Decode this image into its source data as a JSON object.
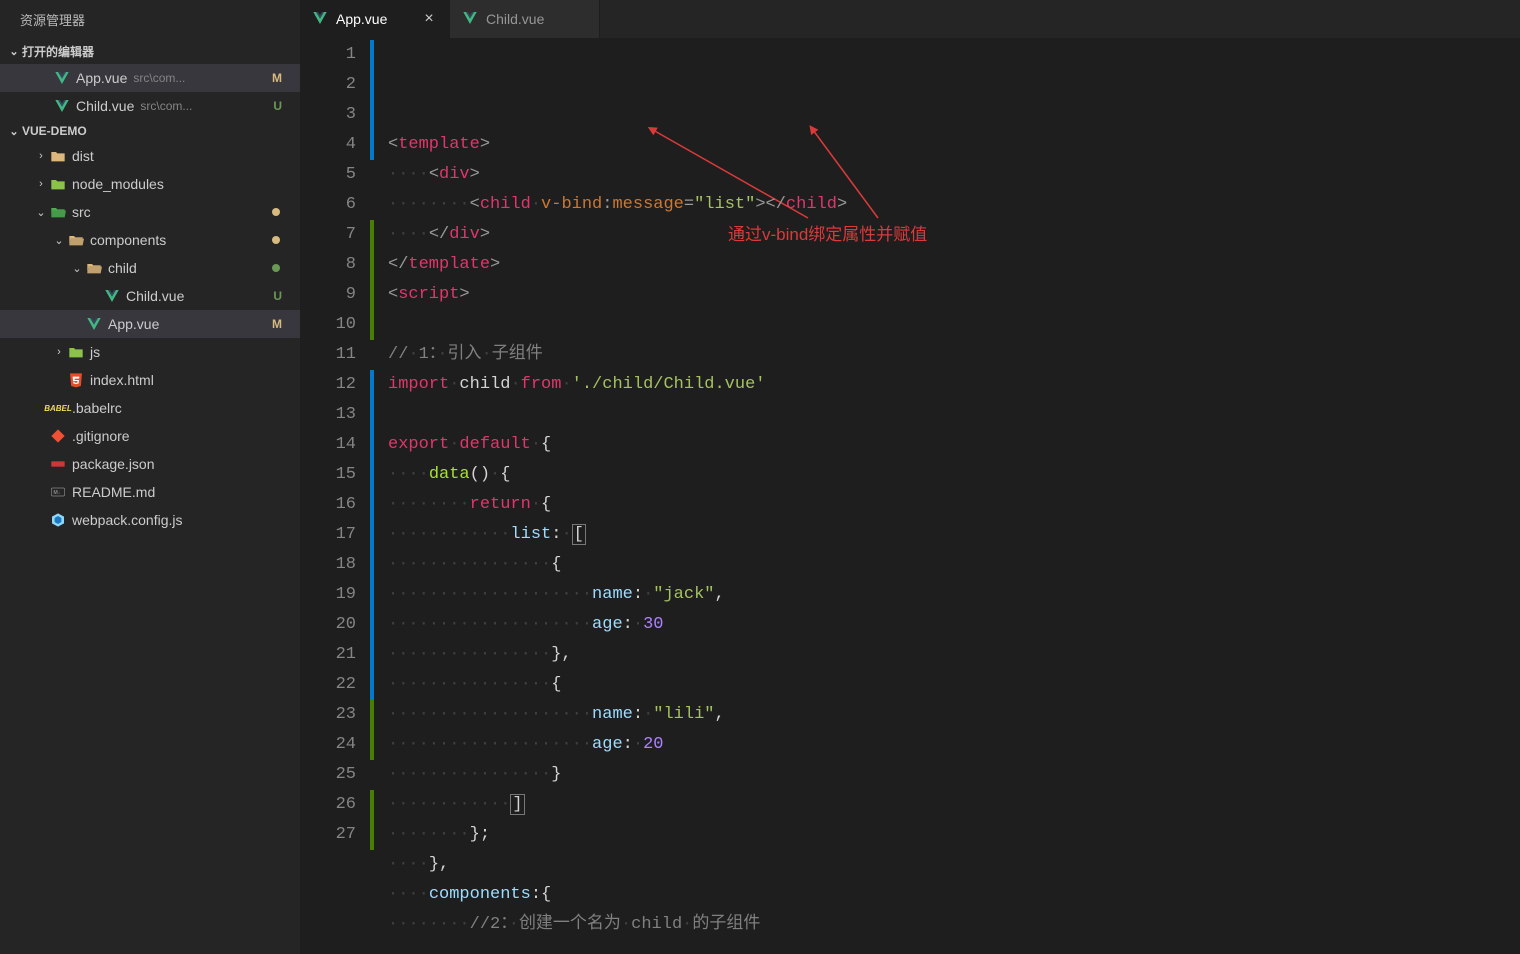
{
  "sidebar": {
    "title": "资源管理器",
    "openEditorsHeader": "打开的编辑器",
    "projectHeader": "VUE-DEMO",
    "openEditors": [
      {
        "name": "App.vue",
        "path": "src\\com...",
        "badge": "M",
        "icon": "vue"
      },
      {
        "name": "Child.vue",
        "path": "src\\com...",
        "badge": "U",
        "icon": "vue"
      }
    ],
    "tree": [
      {
        "indent": 1,
        "type": "folder-closed",
        "name": "dist",
        "chev": "›"
      },
      {
        "indent": 1,
        "type": "folder-closed-js",
        "name": "node_modules",
        "chev": "›"
      },
      {
        "indent": 1,
        "type": "folder-open-src",
        "name": "src",
        "chev": "⌄",
        "dot": "modified"
      },
      {
        "indent": 2,
        "type": "folder-open",
        "name": "components",
        "chev": "⌄",
        "dot": "modified"
      },
      {
        "indent": 3,
        "type": "folder-open-plain",
        "name": "child",
        "chev": "⌄",
        "dot": "untracked"
      },
      {
        "indent": 4,
        "type": "vue",
        "name": "Child.vue",
        "badge": "U"
      },
      {
        "indent": 3,
        "type": "vue",
        "name": "App.vue",
        "badge": "M",
        "active": true
      },
      {
        "indent": 2,
        "type": "folder-closed-js",
        "name": "js",
        "chev": "›"
      },
      {
        "indent": 2,
        "type": "html",
        "name": "index.html"
      },
      {
        "indent": 1,
        "type": "babel",
        "name": ".babelrc"
      },
      {
        "indent": 1,
        "type": "git",
        "name": ".gitignore"
      },
      {
        "indent": 1,
        "type": "npm",
        "name": "package.json"
      },
      {
        "indent": 1,
        "type": "md",
        "name": "README.md"
      },
      {
        "indent": 1,
        "type": "webpack",
        "name": "webpack.config.js"
      }
    ]
  },
  "tabs": [
    {
      "name": "App.vue",
      "active": true,
      "icon": "vue",
      "close": "×"
    },
    {
      "name": "Child.vue",
      "active": false,
      "icon": "vue",
      "close": ""
    }
  ],
  "annotation": "通过v-bind绑定属性并赋值",
  "code": {
    "lines": [
      {
        "n": 1,
        "bar": "blue",
        "html": "<span class='punct'>&lt;</span><span class='tag'>template</span><span class='punct'>&gt;</span>"
      },
      {
        "n": 2,
        "bar": "blue",
        "html": "<span class='ws'>····</span><span class='punct'>&lt;</span><span class='tag'>div</span><span class='punct'>&gt;</span>"
      },
      {
        "n": 3,
        "bar": "blue",
        "html": "<span class='ws'>········</span><span class='punct'>&lt;</span><span class='tag'>child</span><span class='ws'>·</span><span class='attr'>v-bind</span><span class='punct'>:</span><span class='attr'>message</span><span class='punct'>=</span><span class='str'>\"list\"</span><span class='punct'>&gt;&lt;/</span><span class='tag'>child</span><span class='punct'>&gt;</span>"
      },
      {
        "n": 4,
        "bar": "blue",
        "html": "<span class='ws'>····</span><span class='punct'>&lt;/</span><span class='tag'>div</span><span class='punct'>&gt;</span>"
      },
      {
        "n": 5,
        "bar": "",
        "html": "<span class='punct'>&lt;/</span><span class='tag'>template</span><span class='punct'>&gt;</span>"
      },
      {
        "n": 6,
        "bar": "",
        "html": "<span class='punct'>&lt;</span><span class='tag'>script</span><span class='punct'>&gt;</span>"
      },
      {
        "n": 7,
        "bar": "green",
        "html": ""
      },
      {
        "n": 8,
        "bar": "green",
        "html": "<span class='cmt'>//<span class='ws'>·</span>1：<span class='ws'>·</span>引入<span class='ws'>·</span>子组件</span>"
      },
      {
        "n": 9,
        "bar": "green",
        "html": "<span class='kw2'>import</span><span class='ws'>·</span><span class='white'>child</span><span class='ws'>·</span><span class='kw2'>from</span><span class='ws'>·</span><span class='str'>'./child/Child.vue'</span>"
      },
      {
        "n": 10,
        "bar": "green",
        "html": ""
      },
      {
        "n": 11,
        "bar": "",
        "html": "<span class='kw2'>export</span><span class='ws'>·</span><span class='kw2'>default</span><span class='ws'>·</span><span class='white'>{</span>"
      },
      {
        "n": 12,
        "bar": "blue",
        "html": "<span class='ws'>····</span><span class='fn'>data</span><span class='white'>()</span><span class='ws'>·</span><span class='white'>{</span>"
      },
      {
        "n": 13,
        "bar": "blue",
        "html": "<span class='ws'>········</span><span class='kw2'>return</span><span class='ws'>·</span><span class='white'>{</span>"
      },
      {
        "n": 14,
        "bar": "blue",
        "html": "<span class='ws'>············</span><span class='prop'>list</span><span class='white'>:</span><span class='ws'>·</span><span class='white bracket-box'>[</span>"
      },
      {
        "n": 15,
        "bar": "blue",
        "html": "<span class='ws'>················</span><span class='white'>{</span>"
      },
      {
        "n": 16,
        "bar": "blue",
        "html": "<span class='ws'>····················</span><span class='prop'>name</span><span class='white'>:</span><span class='ws'>·</span><span class='str'>\"jack\"</span><span class='white'>,</span>"
      },
      {
        "n": 17,
        "bar": "blue",
        "html": "<span class='ws'>····················</span><span class='prop'>age</span><span class='white'>:</span><span class='ws'>·</span><span class='num'>30</span>"
      },
      {
        "n": 18,
        "bar": "blue",
        "html": "<span class='ws'>················</span><span class='white'>},</span>"
      },
      {
        "n": 19,
        "bar": "blue",
        "html": "<span class='ws'>················</span><span class='white'>{</span>"
      },
      {
        "n": 20,
        "bar": "blue",
        "html": "<span class='ws'>····················</span><span class='prop'>name</span><span class='white'>:</span><span class='ws'>·</span><span class='str'>\"lili\"</span><span class='white'>,</span>"
      },
      {
        "n": 21,
        "bar": "blue",
        "html": "<span class='ws'>····················</span><span class='prop'>age</span><span class='white'>:</span><span class='ws'>·</span><span class='num'>20</span>"
      },
      {
        "n": 22,
        "bar": "blue",
        "html": "<span class='ws'>················</span><span class='white'>}</span>"
      },
      {
        "n": 23,
        "bar": "green",
        "current": true,
        "html": "<span class='ws'>············</span><span class='white bracket-box'>]</span>"
      },
      {
        "n": 24,
        "bar": "green",
        "html": "<span class='ws'>········</span><span class='white'>};</span>"
      },
      {
        "n": 25,
        "bar": "",
        "html": "<span class='ws'>····</span><span class='white'>},</span>"
      },
      {
        "n": 26,
        "bar": "green",
        "html": "<span class='ws'>····</span><span class='prop'>components</span><span class='white'>:{</span>"
      },
      {
        "n": 27,
        "bar": "green",
        "html": "<span class='ws'>········</span><span class='cmt'>//2：<span class='ws'>·</span>创建一个名为<span class='ws'>·</span>child<span class='ws'>·</span>的子组件</span>"
      }
    ]
  }
}
